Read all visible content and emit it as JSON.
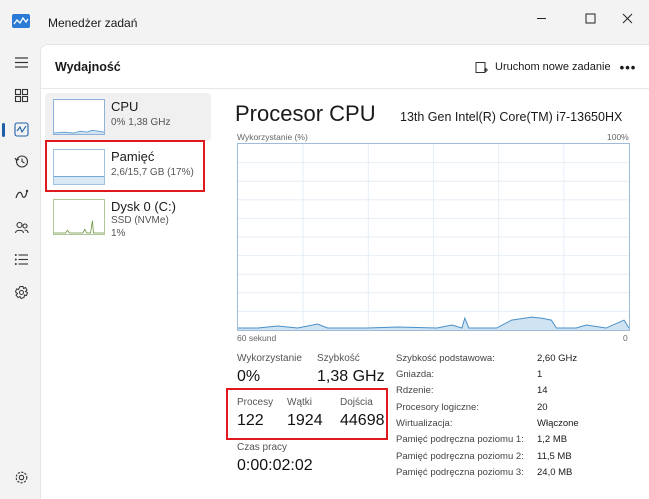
{
  "app": {
    "title": "Menedżer zadań"
  },
  "header": {
    "title": "Wydajność",
    "new_task_label": "Uruchom nowe zadanie",
    "more_label": "•••"
  },
  "nav": [
    "hamburger-icon",
    "processes-icon",
    "performance-icon",
    "app-history-icon",
    "startup-icon",
    "users-icon",
    "details-icon",
    "services-icon",
    "settings-icon"
  ],
  "devices": [
    {
      "name": "CPU",
      "line1": "0%  1,38 GHz",
      "line2": ""
    },
    {
      "name": "Pamięć",
      "line1": "2,6/15,7 GB (17%)",
      "line2": ""
    },
    {
      "name": "Dysk 0 (C:)",
      "line1": "SSD (NVMe)",
      "line2": "1%"
    }
  ],
  "main": {
    "title": "Procesor CPU",
    "model": "13th Gen Intel(R) Core(TM) i7-13650HX",
    "graph_top_label": "Wykorzystanie (%)",
    "graph_max": "100%",
    "graph_time": "60 sekund",
    "graph_min": "0"
  },
  "stats": {
    "utilization_label": "Wykorzystanie",
    "utilization_value": "0%",
    "speed_label": "Szybkość",
    "speed_value": "1,38 GHz",
    "processes_label": "Procesy",
    "processes_value": "122",
    "threads_label": "Wątki",
    "threads_value": "1924",
    "handles_label": "Dojścia",
    "handles_value": "44698",
    "uptime_label": "Czas pracy",
    "uptime_value": "0:00:02:02"
  },
  "specs": [
    {
      "label": "Szybkość podstawowa:",
      "value": "2,60 GHz"
    },
    {
      "label": "Gniazda:",
      "value": "1"
    },
    {
      "label": "Rdzenie:",
      "value": "14"
    },
    {
      "label": "Procesory logiczne:",
      "value": "20"
    },
    {
      "label": "Wirtualizacja:",
      "value": "Włączone"
    },
    {
      "label": "Pamięć podręczna poziomu 1:",
      "value": "1,2 MB"
    },
    {
      "label": "Pamięć podręczna poziomu 2:",
      "value": "11,5 MB"
    },
    {
      "label": "Pamięć podręczna poziomu 3:",
      "value": "24,0 MB"
    }
  ],
  "colors": {
    "accent": "#1f5fa8",
    "graph_line": "#4a90c8",
    "graph_fill": "#cfe3f3",
    "highlight": "#e0191f"
  }
}
